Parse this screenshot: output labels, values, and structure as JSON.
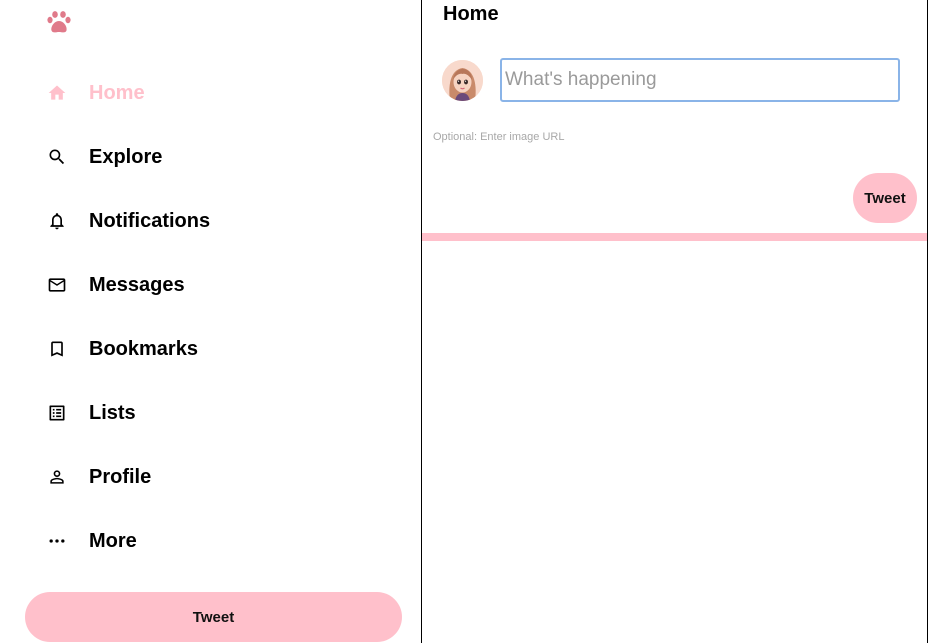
{
  "colors": {
    "accent": "#ffc0cb",
    "logo": "#e07a8a",
    "input_border": "#8ab4e8"
  },
  "sidebar": {
    "logo_icon": "paw-icon",
    "items": [
      {
        "label": "Home",
        "icon": "home-icon",
        "active": true
      },
      {
        "label": "Explore",
        "icon": "search-icon",
        "active": false
      },
      {
        "label": "Notifications",
        "icon": "bell-icon",
        "active": false
      },
      {
        "label": "Messages",
        "icon": "mail-icon",
        "active": false
      },
      {
        "label": "Bookmarks",
        "icon": "bookmark-icon",
        "active": false
      },
      {
        "label": "Lists",
        "icon": "list-icon",
        "active": false
      },
      {
        "label": "Profile",
        "icon": "person-icon",
        "active": false
      },
      {
        "label": "More",
        "icon": "more-icon",
        "active": false
      }
    ],
    "tweet_button_label": "Tweet"
  },
  "main": {
    "title": "Home",
    "composer": {
      "text_placeholder": "What's happening",
      "text_value": "",
      "image_placeholder": "Optional: Enter image URL",
      "image_value": "",
      "tweet_button_label": "Tweet"
    }
  }
}
